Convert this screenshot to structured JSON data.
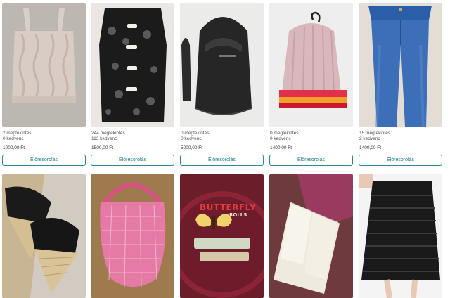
{
  "items": [
    {
      "views": "2 megtekintés",
      "likes": "0 kedvenc",
      "price": "1000,00 Ft",
      "button": "Előresorolás",
      "image": "beige-knit-crop-top"
    },
    {
      "views": "244 megtekintés",
      "likes": "113 kedvenc",
      "price": "1500,00 Ft",
      "button": "Előresorolás",
      "image": "black-lace-top"
    },
    {
      "views": "0 megtekintés",
      "likes": "0 kedvenc",
      "price": "5000,00 Ft",
      "button": "Előresorolás",
      "image": "black-sling-bag"
    },
    {
      "views": "0 megtekintés",
      "likes": "0 kedvenc",
      "price": "1400,00 Ft",
      "button": "Előresorolás",
      "image": "pink-knit-beanie"
    },
    {
      "views": "15 megtekintés",
      "likes": "2 kedvenc",
      "price": "1400,00 Ft",
      "button": "Előresorolás",
      "image": "blue-jeans"
    }
  ],
  "row2": [
    {
      "image": "black-wedge-sandals"
    },
    {
      "image": "pink-crochet-bag"
    },
    {
      "image": "butterfly-rolls-tin",
      "brand": "BUTTERFLY",
      "sub": "ROLLS"
    },
    {
      "image": "white-soap-bars"
    },
    {
      "image": "black-striped-skirt"
    }
  ],
  "colors": {
    "accent": "#2a8c92"
  }
}
